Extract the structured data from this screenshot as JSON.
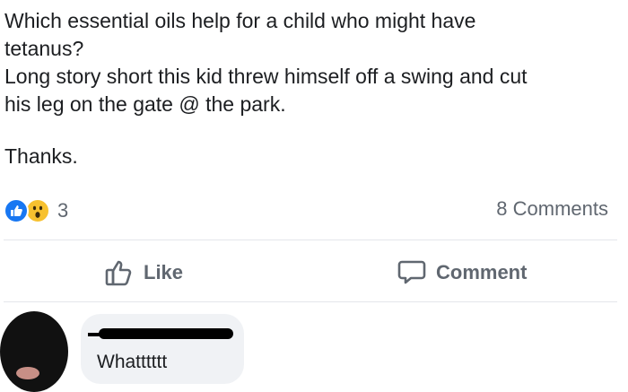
{
  "post": {
    "lines": [
      "Which essential oils help for a child who might have",
      "tetanus?",
      "Long story short this kid threw himself off a swing and cut",
      "his leg on the gate @ the park.",
      "Thanks."
    ]
  },
  "reactions": {
    "count": "3",
    "icons": [
      "like-icon",
      "wow-icon"
    ]
  },
  "comments_count": "8 Comments",
  "actions": {
    "like_label": "Like",
    "comment_label": "Comment"
  },
  "comment": {
    "text": "Whatttttt"
  },
  "colors": {
    "like_blue": "#1877f2",
    "wow_yellow": "#f7c12f",
    "muted": "#606770",
    "bubble": "#f0f2f5"
  }
}
